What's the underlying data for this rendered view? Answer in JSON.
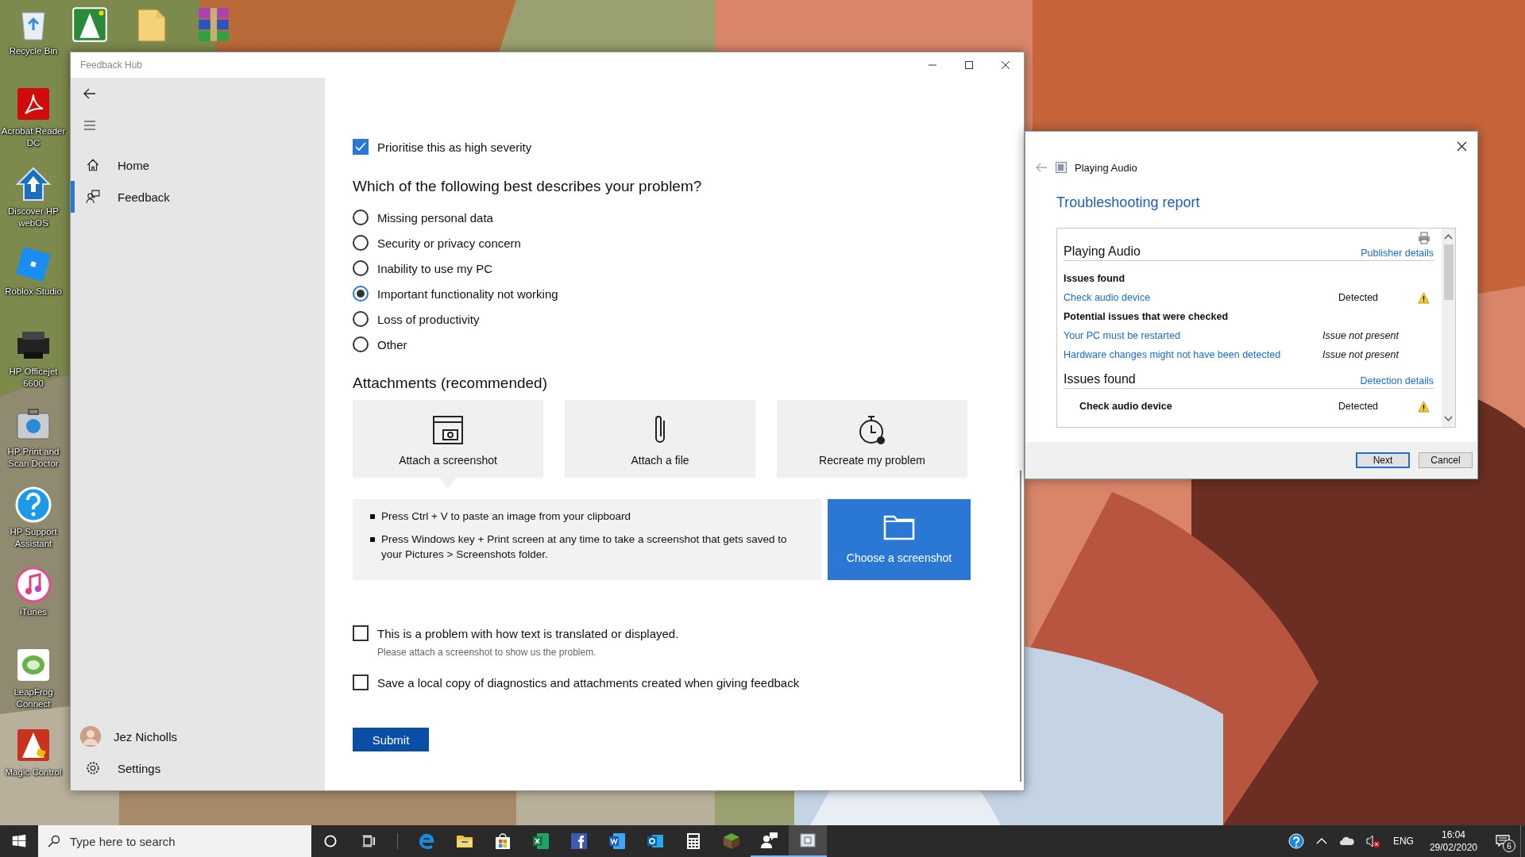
{
  "desktop": {
    "icons": [
      {
        "label": "Recycle Bin",
        "kind": "recycle"
      },
      {
        "label": "Acrobat Reader DC",
        "kind": "acrobat"
      },
      {
        "label": "Discover HP webOS",
        "kind": "webos"
      },
      {
        "label": "Roblox Studio",
        "kind": "roblox"
      },
      {
        "label": "HP Officejet 6600",
        "kind": "printer"
      },
      {
        "label": "HP Print and Scan Doctor",
        "kind": "case"
      },
      {
        "label": "HP Support Assistant",
        "kind": "help"
      },
      {
        "label": "iTunes",
        "kind": "music"
      },
      {
        "label": "LeapFrog Connect",
        "kind": "leapfrog"
      },
      {
        "label": "Magic Control",
        "kind": "wizard"
      }
    ],
    "top_icons": [
      {
        "kind": "wizardgreen"
      },
      {
        "kind": "folder"
      },
      {
        "kind": "archive"
      }
    ]
  },
  "feedback_hub": {
    "title": "Feedback Hub",
    "nav": [
      {
        "label": "Home",
        "kind": "home",
        "selected": false
      },
      {
        "label": "Feedback",
        "kind": "feedback",
        "selected": true
      }
    ],
    "user": "Jez Nicholls",
    "settings": "Settings",
    "severity": {
      "label": "Prioritise this as high severity",
      "checked": true
    },
    "question": "Which of the following best describes your problem?",
    "options": [
      {
        "label": "Missing personal data",
        "selected": false
      },
      {
        "label": "Security or privacy concern",
        "selected": false
      },
      {
        "label": "Inability to use my PC",
        "selected": false
      },
      {
        "label": "Important functionality not working",
        "selected": true
      },
      {
        "label": "Loss of productivity",
        "selected": false
      },
      {
        "label": "Other",
        "selected": false
      }
    ],
    "attachments_heading": "Attachments (recommended)",
    "attachment_tiles": [
      {
        "label": "Attach a screenshot",
        "kind": "screenshot",
        "selected": true
      },
      {
        "label": "Attach a file",
        "kind": "file",
        "selected": false
      },
      {
        "label": "Recreate my problem",
        "kind": "recreate",
        "selected": false
      }
    ],
    "instructions": [
      "Press Ctrl + V to paste an image from your clipboard",
      "Press Windows key + Print screen at any time to take a screenshot that gets saved to your Pictures > Screenshots folder."
    ],
    "choose_button": "Choose a screenshot",
    "checkboxes": [
      {
        "label": "This is a problem with how text is translated or displayed.",
        "hint": "Please attach a screenshot to show us the problem.",
        "checked": false
      },
      {
        "label": "Save a local copy of diagnostics and attachments created when giving feedback",
        "checked": false
      }
    ],
    "submit": "Submit"
  },
  "troubleshooter": {
    "title": "Playing Audio",
    "heading": "Troubleshooting report",
    "items": [
      {
        "kind": "section",
        "title": "Playing Audio",
        "link": "Publisher details"
      },
      {
        "kind": "subheading",
        "text": "Issues found"
      },
      {
        "kind": "link_row",
        "label": "Check audio device",
        "status": "Detected",
        "warning": true
      },
      {
        "kind": "subheading",
        "text": "Potential issues that were checked"
      },
      {
        "kind": "link_row",
        "label": "Your PC must be restarted",
        "status": "Issue not present",
        "warning": false
      },
      {
        "kind": "link_row",
        "label": "Hardware changes might not have been detected",
        "status": "Issue not present",
        "warning": false
      },
      {
        "kind": "section",
        "title": "Issues found",
        "link": "Detection details"
      },
      {
        "kind": "bold_row",
        "label": "Check audio device",
        "status": "Detected",
        "warning": true
      }
    ],
    "buttons": [
      {
        "label": "Next",
        "default": true
      },
      {
        "label": "Cancel",
        "default": false
      }
    ]
  },
  "taskbar": {
    "search_placeholder": "Type here to search",
    "apps": [
      {
        "kind": "edge",
        "running": false,
        "selected": false
      },
      {
        "kind": "explorer",
        "running": false,
        "selected": false
      },
      {
        "kind": "store",
        "running": false,
        "selected": false
      },
      {
        "kind": "excel",
        "running": false,
        "selected": false
      },
      {
        "kind": "facebook",
        "running": false,
        "selected": false
      },
      {
        "kind": "word",
        "running": false,
        "selected": false
      },
      {
        "kind": "outlook",
        "running": false,
        "selected": false
      },
      {
        "kind": "calculator",
        "running": false,
        "selected": false
      },
      {
        "kind": "minecraft",
        "running": false,
        "selected": false
      },
      {
        "kind": "feedback",
        "running": true,
        "selected": false
      },
      {
        "kind": "troubleshooter",
        "running": true,
        "selected": true
      }
    ],
    "language": "ENG",
    "time": "16:04",
    "date": "29/02/2020",
    "notifications": "6"
  }
}
